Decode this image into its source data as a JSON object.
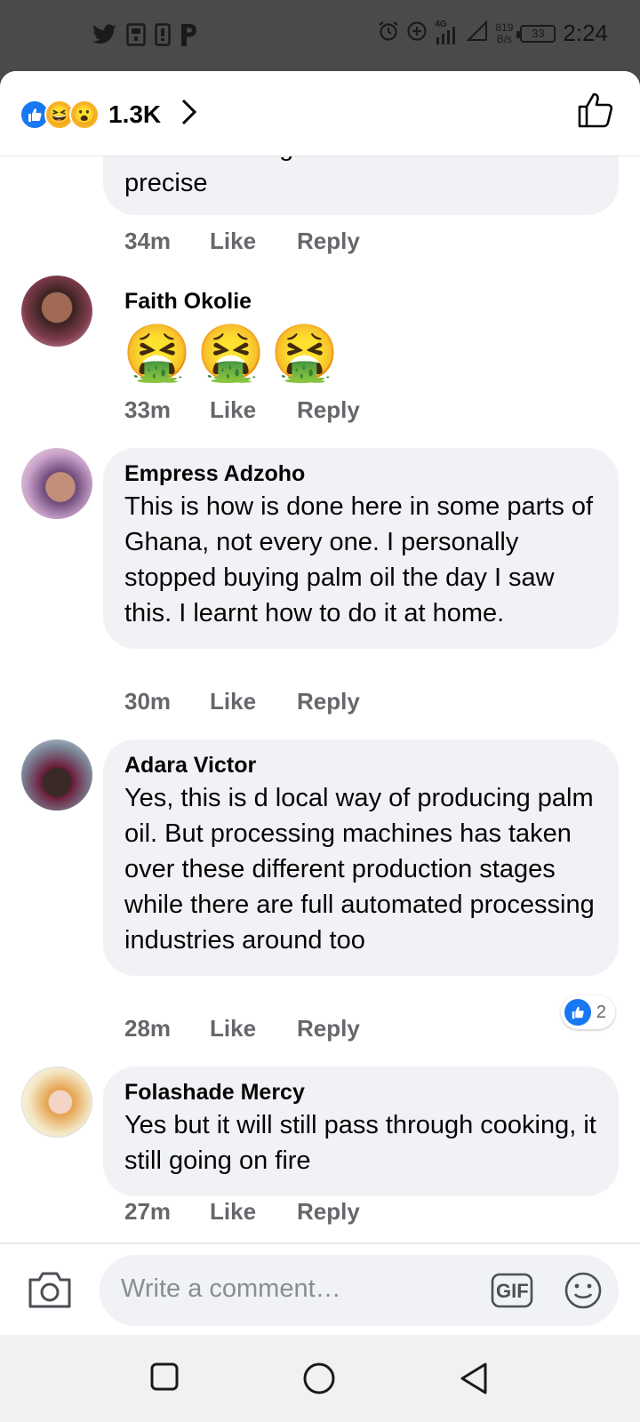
{
  "status_bar": {
    "time": "2:24",
    "network": "4G",
    "speed_value": "819",
    "speed_unit": "B/s",
    "battery": "33",
    "left_icons": [
      "twitter-icon",
      "sim-icon",
      "sim-icon-2",
      "paypal-icon"
    ]
  },
  "header": {
    "reaction_count": "1.3K",
    "reactions": [
      "like",
      "haha",
      "wow"
    ]
  },
  "comments": [
    {
      "author": "",
      "text": "Not so in Enugu State Nkanu to be precise",
      "time": "34m",
      "like_label": "Like",
      "reply_label": "Reply"
    },
    {
      "author": "Faith Okolie",
      "emojis": [
        "🤮",
        "🤮",
        "🤮"
      ],
      "time": "33m",
      "like_label": "Like",
      "reply_label": "Reply"
    },
    {
      "author": "Empress Adzoho",
      "text": "This is how is done here in some parts of Ghana, not every one. I personally stopped buying palm oil the day I saw this. I learnt how to do it at home.",
      "time": "30m",
      "like_label": "Like",
      "reply_label": "Reply"
    },
    {
      "author": "Adara Victor",
      "text": "Yes, this is d local way of producing palm oil. But processing machines has taken over these different production stages while there are full automated processing industries around too",
      "time": "28m",
      "like_label": "Like",
      "reply_label": "Reply",
      "like_count": "2"
    },
    {
      "author": "Folashade Mercy",
      "text": "Yes but it will still pass through cooking, it still going on fire",
      "time": "27m",
      "like_label": "Like",
      "reply_label": "Reply"
    }
  ],
  "composer": {
    "placeholder": "Write a comment…",
    "gif_label": "GIF"
  },
  "colors": {
    "accent": "#1877f2",
    "bubble": "#f0f2f5",
    "meta_text": "#65676b"
  }
}
